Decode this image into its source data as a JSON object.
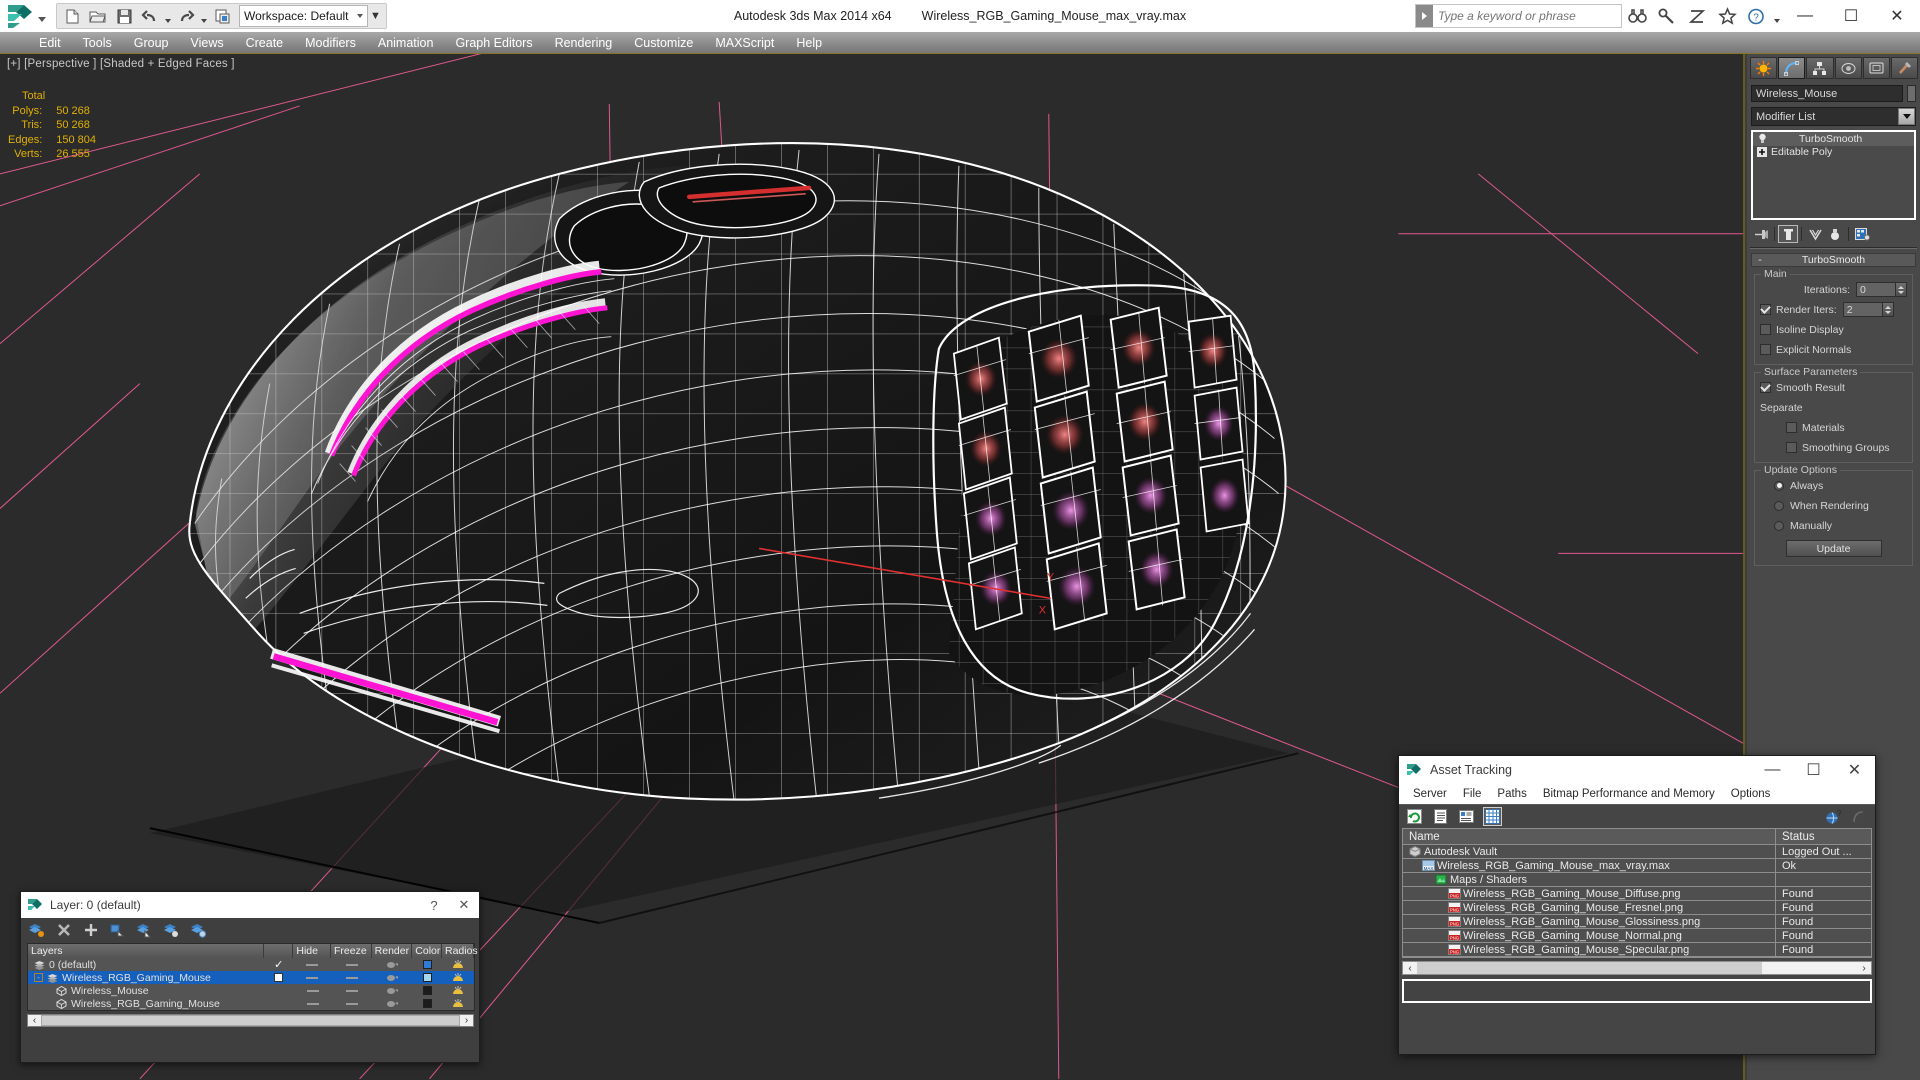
{
  "app": {
    "title": "Autodesk 3ds Max  2014 x64",
    "document": "Wireless_RGB_Gaming_Mouse_max_vray.max",
    "workspace": "Workspace: Default",
    "search_placeholder": "Type a keyword or phrase"
  },
  "quick_access": [
    {
      "name": "new-file-icon",
      "label": "New"
    },
    {
      "name": "open-file-icon",
      "label": "Open"
    },
    {
      "name": "save-file-icon",
      "label": "Save"
    },
    {
      "name": "undo-icon",
      "label": "Undo"
    },
    {
      "name": "redo-icon",
      "label": "Redo"
    },
    {
      "name": "project-folder-icon",
      "label": "Set Project Folder"
    }
  ],
  "menubar": [
    "Edit",
    "Tools",
    "Group",
    "Views",
    "Create",
    "Modifiers",
    "Animation",
    "Graph Editors",
    "Rendering",
    "Customize",
    "MAXScript",
    "Help"
  ],
  "window_controls": {
    "minimize": "—",
    "maximize": "☐",
    "close": "✕"
  },
  "viewport": {
    "label": "[+] [Perspective ] [Shaded + Edged Faces ]",
    "stats": {
      "header": "Total",
      "rows": [
        {
          "key": "Polys:",
          "value": "50 268"
        },
        {
          "key": "Tris:",
          "value": "50 268"
        },
        {
          "key": "Edges:",
          "value": "150 804"
        },
        {
          "key": "Verts:",
          "value": "26 555"
        }
      ]
    },
    "stats_color": "#e0b000",
    "background_color": "#2b2b2b",
    "wireframe_color": "#ffffff",
    "grid_color": "#ff5fa2",
    "rgb_strip_color": "#ff14d4",
    "accent_red": "#e03030"
  },
  "command_panel": {
    "tabs": [
      {
        "name": "create-tab",
        "label": "Create",
        "active": false
      },
      {
        "name": "modify-tab",
        "label": "Modify",
        "active": true
      },
      {
        "name": "hierarchy-tab",
        "label": "Hierarchy",
        "active": false
      },
      {
        "name": "motion-tab",
        "label": "Motion",
        "active": false
      },
      {
        "name": "display-tab",
        "label": "Display",
        "active": false
      },
      {
        "name": "utilities-tab",
        "label": "Utilities",
        "active": false
      }
    ],
    "object_name": "Wireless_Mouse",
    "modifier_list_label": "Modifier List",
    "stack": [
      {
        "label": "TurboSmooth",
        "icon": "lightbulb-icon",
        "highlight": true
      },
      {
        "label": "Editable Poly",
        "icon": "plus-box-icon",
        "highlight": false
      }
    ],
    "stack_tools": [
      {
        "name": "pin-stack-icon"
      },
      {
        "name": "show-end-result-icon",
        "active": true
      },
      {
        "name": "make-unique-icon"
      },
      {
        "name": "remove-modifier-icon"
      },
      {
        "name": "configure-modifier-sets-icon"
      }
    ],
    "rollout": {
      "title": "TurboSmooth",
      "collapse_sign": "-",
      "main": {
        "title": "Main",
        "iterations_label": "Iterations:",
        "iterations_value": "0",
        "render_iters_label": "Render Iters:",
        "render_iters_value": "2",
        "render_iters_checked": true,
        "isoline_display_label": "Isoline Display",
        "isoline_display_checked": false,
        "explicit_normals_label": "Explicit Normals",
        "explicit_normals_checked": false
      },
      "surface": {
        "title": "Surface Parameters",
        "smooth_result_label": "Smooth Result",
        "smooth_result_checked": true,
        "separate_label": "Separate",
        "materials_label": "Materials",
        "materials_checked": false,
        "smoothing_groups_label": "Smoothing Groups",
        "smoothing_groups_checked": false
      },
      "update": {
        "title": "Update Options",
        "options": [
          {
            "label": "Always",
            "selected": true
          },
          {
            "label": "When Rendering",
            "selected": false
          },
          {
            "label": "Manually",
            "selected": false
          }
        ],
        "button_label": "Update"
      }
    }
  },
  "layer_dialog": {
    "title": "Layer: 0 (default)",
    "help_glyph": "?",
    "close_glyph": "✕",
    "tools": [
      {
        "name": "set-current-layer-icon"
      },
      {
        "name": "delete-layer-icon"
      },
      {
        "name": "create-new-layer-icon"
      },
      {
        "name": "add-selection-to-layer-icon"
      },
      {
        "name": "select-objects-in-layer-icon"
      },
      {
        "name": "highlight-selected-objects-layer-icon"
      },
      {
        "name": "layer-properties-icon"
      }
    ],
    "columns": [
      "Layers",
      "",
      "Hide",
      "Freeze",
      "Render",
      "Color",
      "Radios"
    ],
    "rows": [
      {
        "label": "0 (default)",
        "indent": 0,
        "current": true,
        "selected": false,
        "color": "#2e7bd6",
        "expander": "",
        "icon": "layer-icon"
      },
      {
        "label": "Wireless_RGB_Gaming_Mouse",
        "indent": 0,
        "current": false,
        "selected": true,
        "color": "#9fd8ef",
        "expander": "-",
        "icon": "layer-icon"
      },
      {
        "label": "Wireless_Mouse",
        "indent": 1,
        "current": false,
        "selected": false,
        "color": "#1c1c1c",
        "expander": "",
        "icon": "object-icon"
      },
      {
        "label": "Wireless_RGB_Gaming_Mouse",
        "indent": 1,
        "current": false,
        "selected": false,
        "color": "#1c1c1c",
        "expander": "",
        "icon": "object-icon"
      }
    ]
  },
  "asset_tracking": {
    "title": "Asset Tracking",
    "menubar": [
      "Server",
      "File",
      "Paths",
      "Bitmap Performance and Memory",
      "Options"
    ],
    "toolbar": [
      {
        "name": "refresh-icon",
        "active": false
      },
      {
        "name": "list-view-icon",
        "active": false
      },
      {
        "name": "detail-view-icon",
        "active": false
      },
      {
        "name": "grid-view-icon",
        "active": true
      }
    ],
    "toolbar_right": [
      {
        "name": "help-globe-icon"
      },
      {
        "name": "help-question-icon"
      }
    ],
    "columns": [
      "Name",
      "Status"
    ],
    "rows": [
      {
        "name": "Autodesk Vault",
        "status": "Logged Out ...",
        "indent": 0,
        "icon": "vault-icon"
      },
      {
        "name": "Wireless_RGB_Gaming_Mouse_max_vray.max",
        "status": "Ok",
        "indent": 1,
        "icon": "max-file-icon"
      },
      {
        "name": "Maps / Shaders",
        "status": "",
        "indent": 2,
        "icon": "maps-shaders-icon"
      },
      {
        "name": "Wireless_RGB_Gaming_Mouse_Diffuse.png",
        "status": "Found",
        "indent": 3,
        "icon": "png-icon"
      },
      {
        "name": "Wireless_RGB_Gaming_Mouse_Fresnel.png",
        "status": "Found",
        "indent": 3,
        "icon": "png-icon"
      },
      {
        "name": "Wireless_RGB_Gaming_Mouse_Glossiness.png",
        "status": "Found",
        "indent": 3,
        "icon": "png-icon"
      },
      {
        "name": "Wireless_RGB_Gaming_Mouse_Normal.png",
        "status": "Found",
        "indent": 3,
        "icon": "png-icon"
      },
      {
        "name": "Wireless_RGB_Gaming_Mouse_Specular.png",
        "status": "Found",
        "indent": 3,
        "icon": "png-icon"
      }
    ],
    "scroll_left_glyph": "‹",
    "scroll_right_glyph": "›"
  }
}
